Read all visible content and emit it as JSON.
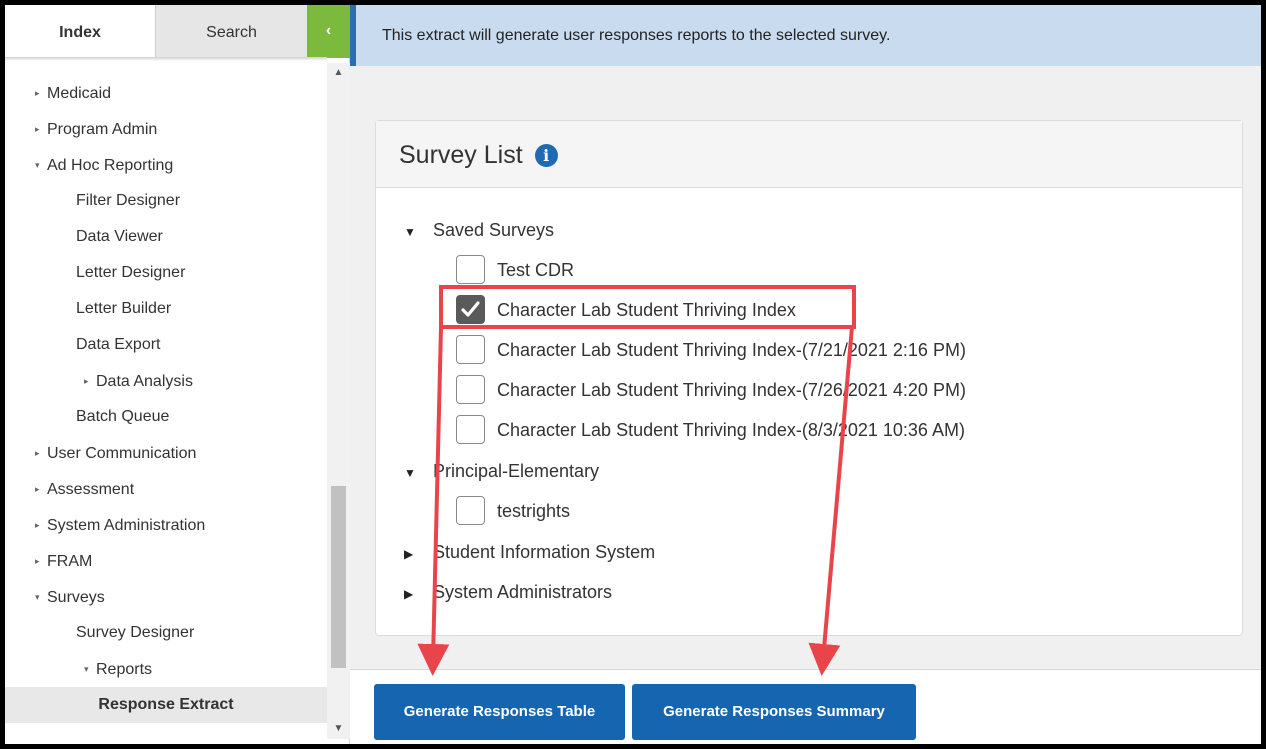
{
  "tabs": {
    "index": "Index",
    "search": "Search",
    "collapse": "‹"
  },
  "nav": {
    "items": [
      {
        "label": "Medicaid",
        "tri": "▸"
      },
      {
        "label": "Program Admin",
        "tri": "▸"
      },
      {
        "label": "Ad Hoc Reporting",
        "tri": "▾"
      },
      {
        "label": "Filter Designer"
      },
      {
        "label": "Data Viewer"
      },
      {
        "label": "Letter Designer"
      },
      {
        "label": "Letter Builder"
      },
      {
        "label": "Data Export"
      },
      {
        "label": "Data Analysis",
        "tri": "▸"
      },
      {
        "label": "Batch Queue"
      },
      {
        "label": "User Communication",
        "tri": "▸"
      },
      {
        "label": "Assessment",
        "tri": "▸"
      },
      {
        "label": "System Administration",
        "tri": "▸"
      },
      {
        "label": "FRAM",
        "tri": "▸"
      },
      {
        "label": "Surveys",
        "tri": "▾"
      },
      {
        "label": "Survey Designer"
      },
      {
        "label": "Reports",
        "tri": "▾"
      },
      {
        "label": "Response Extract"
      }
    ]
  },
  "banner": {
    "text": "This extract will generate user responses reports to the selected survey."
  },
  "panel": {
    "title": "Survey List",
    "info_icon": "i",
    "groups": [
      {
        "label": "Saved Surveys",
        "arrow": "▼"
      },
      {
        "label": "Principal-Elementary",
        "arrow": "▼"
      },
      {
        "label": "Student Information System",
        "arrow": "▶"
      },
      {
        "label": "System Administrators",
        "arrow": "▶"
      }
    ],
    "surveys": [
      {
        "label": "Test CDR",
        "checked": false
      },
      {
        "label": "Character Lab Student Thriving Index",
        "checked": true
      },
      {
        "label": "Character Lab Student Thriving Index-(7/21/2021 2:16 PM)",
        "checked": false
      },
      {
        "label": "Character Lab Student Thriving Index-(7/26/2021 4:20 PM)",
        "checked": false
      },
      {
        "label": "Character Lab Student Thriving Index-(8/3/2021 10:36 AM)",
        "checked": false
      },
      {
        "label": "testrights",
        "checked": false
      }
    ]
  },
  "buttons": {
    "table": "Generate Responses Table",
    "summary": "Generate Responses Summary"
  },
  "colors": {
    "accent": "#1565b0",
    "banner_bg": "#c9dcef",
    "collapse_tab": "#7cba3d",
    "annotation": "#e8444a"
  }
}
